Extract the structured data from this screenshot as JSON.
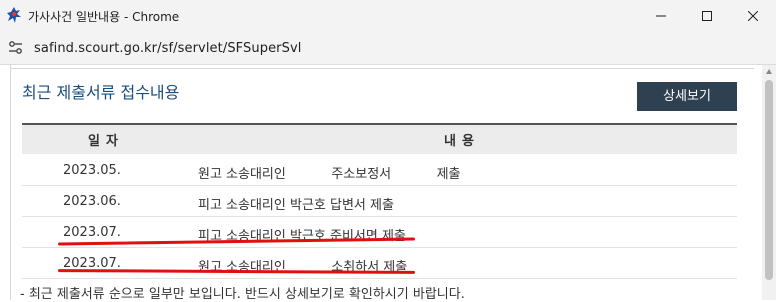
{
  "window": {
    "title": "가사사건 일반내용 - Chrome"
  },
  "address_bar": {
    "url": "safind.scourt.go.kr/sf/servlet/SFSuperSvl"
  },
  "section": {
    "title": "최근 제출서류 접수내용",
    "detail_button": "상세보기"
  },
  "table": {
    "headers": {
      "date": "일자",
      "content": "내용"
    },
    "rows": [
      {
        "date": "2023.05.",
        "content": "원고 소송대리인           주소보정서           제출",
        "highlighted": false
      },
      {
        "date": "2023.06.",
        "content": "피고 소송대리인 박근호 답변서 제출",
        "highlighted": false
      },
      {
        "date": "2023.07.",
        "content": "피고 소송대리인 박근호 준비서면 제출",
        "highlighted": true
      },
      {
        "date": "2023.07.",
        "content": "원고 소송대리인           소취하서 제출",
        "highlighted": true
      }
    ]
  },
  "footnote": "- 최근 제출서류 순으로 일부만 보입니다. 반드시 상세보기로 확인하시기 바랍니다.",
  "colors": {
    "section_title": "#1a4d80",
    "detail_button_bg": "#2f4050",
    "annotation_red": "#e01010"
  }
}
